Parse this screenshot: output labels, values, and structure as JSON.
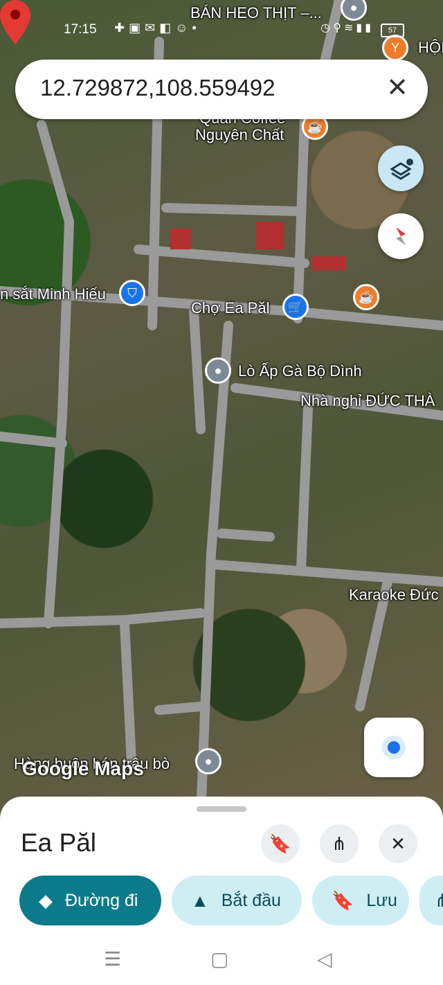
{
  "status_bar": {
    "time": "17:15",
    "battery": "57"
  },
  "search": {
    "query": "12.729872,108.559492"
  },
  "map": {
    "labels": {
      "ban_heo": "BÁN HEO THỊT –...",
      "hoi": "HỘI",
      "quan_coffee": "Quán Coffee",
      "nguyen_chat": "Nguyên Chất",
      "minh_hieu": "n sắt Minh Hiếu",
      "cho_ea_pal": "Chợ Ea Păl",
      "lo_ap": "Lò Ấp Gà Bộ Dình",
      "nha_nghi": "Nhà nghỉ ĐỨC THÀ",
      "karaoke": "Karaoke Đức",
      "hang_buon": "Hàng buôn bán trâu bò"
    },
    "watermark": "Google Maps"
  },
  "sheet": {
    "title": "Ea Păl",
    "directions_label": "Đường đi",
    "start_label": "Bắt đầu",
    "save_label": "Lưu"
  },
  "colors": {
    "primary": "#0b7a8a",
    "secondary": "#cfeef4",
    "pin": "#e53935"
  }
}
